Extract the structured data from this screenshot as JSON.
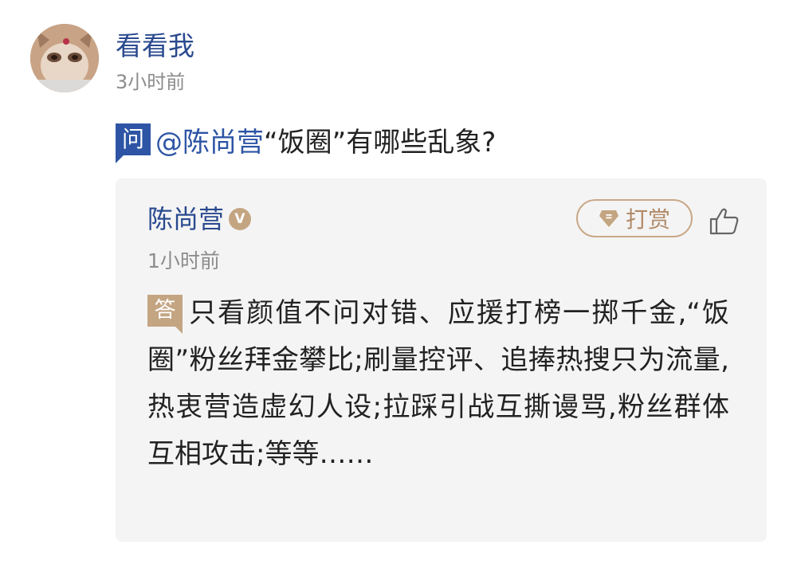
{
  "post": {
    "username": "看看我",
    "time": "3小时前"
  },
  "question": {
    "badge": "问",
    "mention": "@陈尚营",
    "text": "“饭圈”有哪些乱象?"
  },
  "answer": {
    "author": "陈尚营",
    "verified_badge": "V",
    "tip_label": "打赏",
    "time": "1小时前",
    "badge": "答",
    "text": "只看颜值不问对错、应援打榜一掷千金,“饭圈”粉丝拜金攀比;刷量控评、追捧热搜只为流量,热衷营造虚幻人设;拉踩引战互撕谩骂,粉丝群体互相攻击;等等……"
  },
  "icons": {
    "verified": "verified-v-icon",
    "tip": "gem-icon",
    "like": "thumbs-up-icon"
  },
  "colors": {
    "link_blue": "#2a4a8f",
    "question_badge": "#2e55a5",
    "gold_accent": "#c4a582",
    "card_background": "#f4f4f4",
    "meta_gray": "#8c8c8c"
  }
}
